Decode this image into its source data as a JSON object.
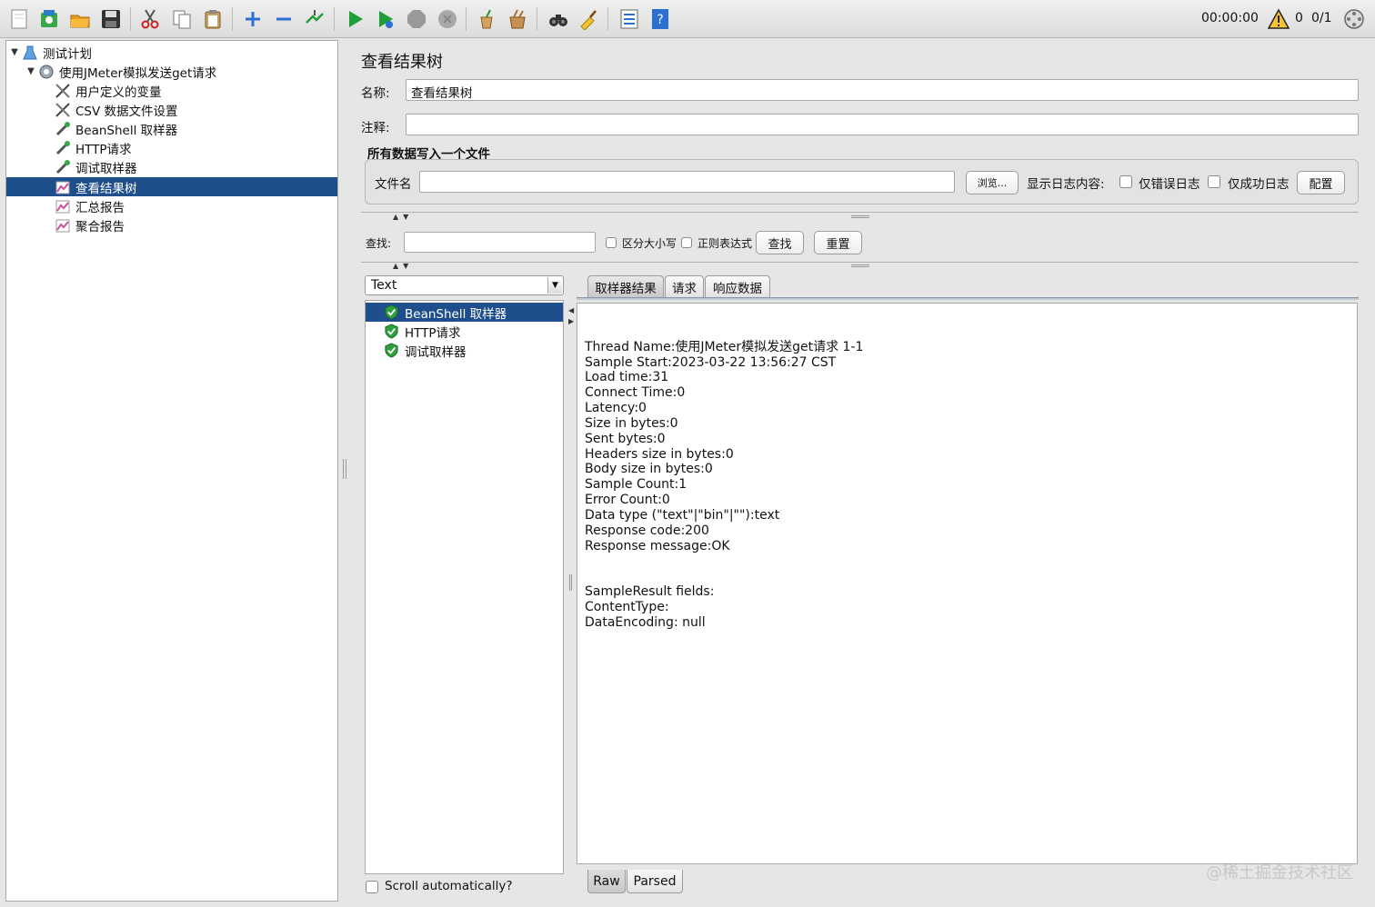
{
  "toolbar": {
    "icons": [
      "new-icon",
      "templates-icon",
      "open-icon",
      "save-icon",
      "cut-icon",
      "copy-icon",
      "paste-icon",
      "expand-icon",
      "collapse-icon",
      "toggle-icon",
      "start-icon",
      "start-no-pause-icon",
      "stop-icon",
      "shutdown-icon",
      "clear-icon",
      "clear-all-icon",
      "search-icon",
      "reset-search-icon",
      "function-helper-icon",
      "help-icon"
    ],
    "timer": "00:00:00",
    "warning_count": "0",
    "threads": "0/1"
  },
  "tree": {
    "items": [
      {
        "label": "测试计划"
      },
      {
        "label": "使用JMeter模拟发送get请求"
      },
      {
        "label": "用户定义的变量"
      },
      {
        "label": "CSV 数据文件设置"
      },
      {
        "label": "BeanShell 取样器"
      },
      {
        "label": "HTTP请求"
      },
      {
        "label": "调试取样器"
      },
      {
        "label": "查看结果树"
      },
      {
        "label": "汇总报告"
      },
      {
        "label": "聚合报告"
      }
    ]
  },
  "panel": {
    "title": "查看结果树",
    "name_label": "名称:",
    "name_value": "查看结果树",
    "comment_label": "注释:",
    "comment_value": "",
    "file_group_title": "所有数据写入一个文件",
    "filename_label": "文件名",
    "filename_value": "",
    "browse_button": "浏览...",
    "log_label": "显示日志内容:",
    "errors_only": "仅错误日志",
    "success_only": "仅成功日志",
    "configure_button": "配置",
    "search_label": "查找:",
    "search_value": "",
    "case_sensitive": "区分大小写",
    "regex": "正则表达式",
    "find_button": "查找",
    "reset_button": "重置"
  },
  "results": {
    "renderer": "Text",
    "items": [
      {
        "label": "BeanShell 取样器"
      },
      {
        "label": "HTTP请求"
      },
      {
        "label": "调试取样器"
      }
    ],
    "scroll_auto": "Scroll automatically?"
  },
  "tabs": [
    "取样器结果",
    "请求",
    "响应数据"
  ],
  "bottom_tabs": [
    "Raw",
    "Parsed"
  ],
  "detail": {
    "lines": [
      "Thread Name:使用JMeter模拟发送get请求 1-1",
      "Sample Start:2023-03-22 13:56:27 CST",
      "Load time:31",
      "Connect Time:0",
      "Latency:0",
      "Size in bytes:0",
      "Sent bytes:0",
      "Headers size in bytes:0",
      "Body size in bytes:0",
      "Sample Count:1",
      "Error Count:0",
      "Data type (\"text\"|\"bin\"|\"\"):text",
      "Response code:200",
      "Response message:OK",
      "",
      "",
      "SampleResult fields:",
      "ContentType: ",
      "DataEncoding: null"
    ]
  },
  "watermark": "@稀土掘金技术社区",
  "colors": {
    "selection": "#1e4f8c",
    "background": "#e6e6e6"
  }
}
